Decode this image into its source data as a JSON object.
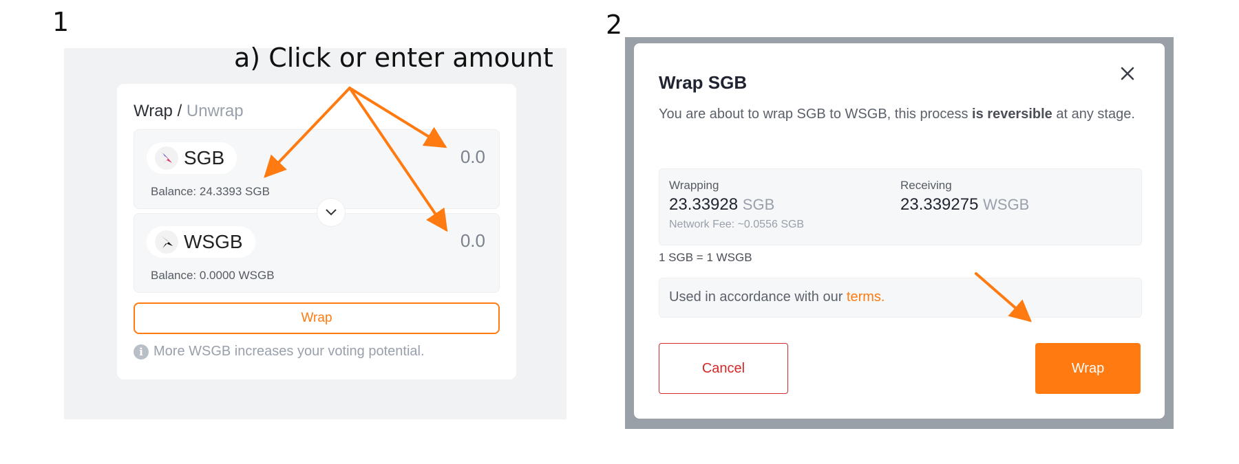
{
  "step_labels": {
    "first": "1",
    "second": "2"
  },
  "annotation": "a) Click or enter amount",
  "wrap_panel": {
    "tab_active": "Wrap",
    "tab_separator": "/",
    "tab_inactive": "Unwrap",
    "from": {
      "token": "SGB",
      "amount": "0.0",
      "balance": "Balance: 24.3393 SGB"
    },
    "to": {
      "token": "WSGB",
      "amount": "0.0",
      "balance": "Balance: 0.0000 WSGB"
    },
    "wrap_button": "Wrap",
    "info_text": "More WSGB increases your voting potential."
  },
  "modal": {
    "title": "Wrap SGB",
    "description_pre": "You are about to wrap SGB to WSGB, this process ",
    "description_bold": "is reversible",
    "description_post": " at any stage.",
    "wrapping": {
      "label": "Wrapping",
      "value": "23.33928",
      "unit": "SGB",
      "fee": "Network Fee: ~0.0556 SGB"
    },
    "receiving": {
      "label": "Receiving",
      "value": "23.339275",
      "unit": "WSGB"
    },
    "rate": "1 SGB = 1 WSGB",
    "terms_text": "Used in accordance with our ",
    "terms_link": "terms.",
    "cancel_button": "Cancel",
    "wrap_button": "Wrap"
  },
  "colors": {
    "accent": "#ff7a10",
    "cancel": "#d62828",
    "overlay": "#9aa0a8"
  },
  "icons": [
    "close-icon",
    "chevron-down-icon",
    "info-icon",
    "sgb-logo-icon",
    "wsgb-logo-icon"
  ]
}
